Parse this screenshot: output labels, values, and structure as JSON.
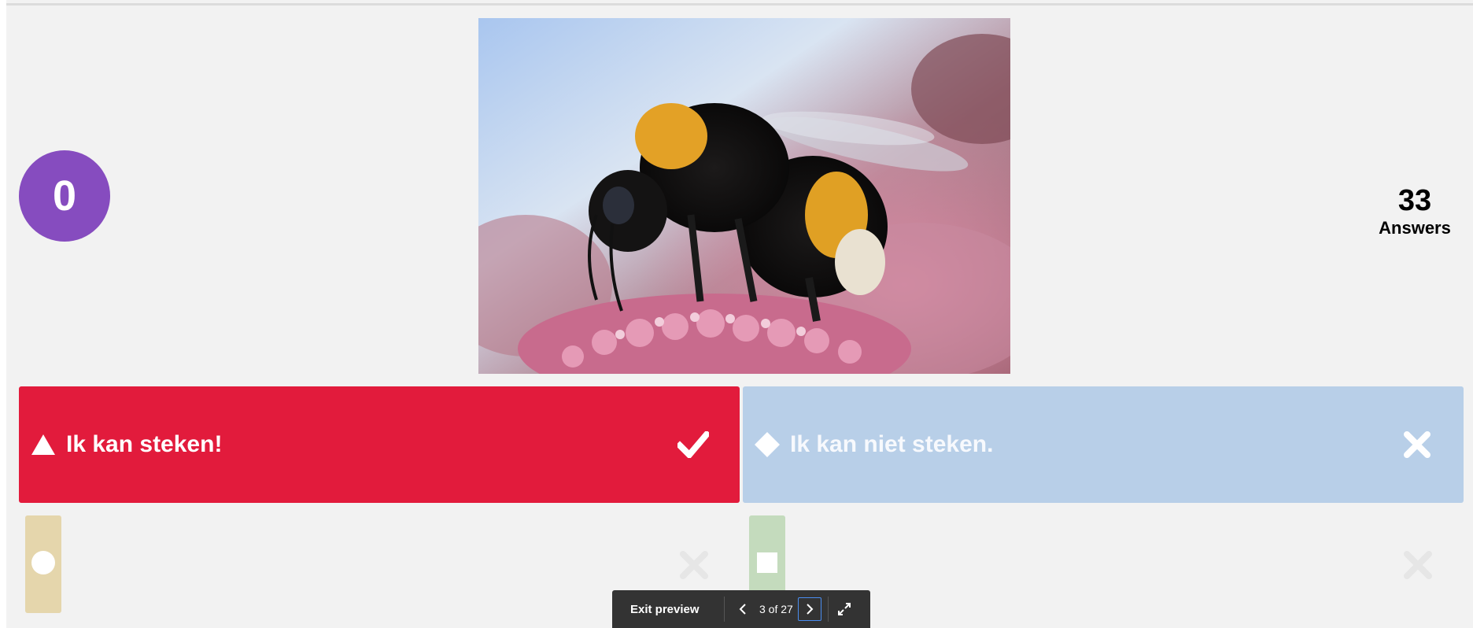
{
  "timer": {
    "value": "0",
    "color": "#864cbf"
  },
  "answers": {
    "count": "33",
    "label": "Answers"
  },
  "question_image": {
    "subject": "bumblebee-on-flower-photo"
  },
  "options": [
    {
      "text": "Ik kan steken!",
      "shape": "triangle-icon",
      "color": "#e21b3c",
      "correct": true,
      "mark": "checkmark-icon"
    },
    {
      "text": "Ik kan niet steken.",
      "shape": "diamond-icon",
      "color": "#b8cfe8",
      "correct": false,
      "mark": "cross-icon"
    },
    {
      "text": "",
      "shape": "circle-icon",
      "color": "#e5d6ac"
    },
    {
      "text": "",
      "shape": "square-icon",
      "color": "#c4dbbd"
    }
  ],
  "toolbar": {
    "exit_label": "Exit preview",
    "counter": "3 of 27"
  }
}
